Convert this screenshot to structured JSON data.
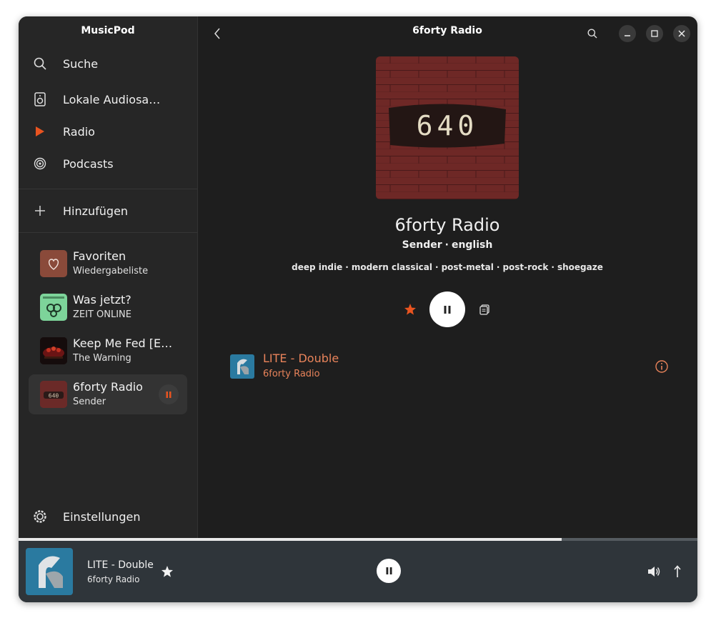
{
  "sidebar": {
    "app_title": "MusicPod",
    "nav": [
      {
        "label": "Suche",
        "icon": "search-icon"
      },
      {
        "label": "Lokale Audiosammlung",
        "icon": "local-audio-icon"
      },
      {
        "label": "Radio",
        "icon": "radio-play-icon"
      },
      {
        "label": "Podcasts",
        "icon": "podcast-icon"
      }
    ],
    "add_label": "Hinzufügen",
    "library": [
      {
        "title": "Favoriten",
        "subtitle": "Wiedergabeliste",
        "icon": "heart-icon"
      },
      {
        "title": "Was jetzt?",
        "subtitle": "ZEIT ONLINE"
      },
      {
        "title": "Keep Me Fed [Explicit]",
        "subtitle": "The Warning"
      },
      {
        "title": "6forty Radio",
        "subtitle": "Sender",
        "active": true
      }
    ],
    "settings_label": "Einstellungen"
  },
  "header": {
    "title": "6forty Radio"
  },
  "station": {
    "cover_text": "640",
    "name": "6forty Radio",
    "type": "Sender",
    "language": "english",
    "tags": [
      "deep indie",
      "modern classical",
      "post-metal",
      "post-rock",
      "shoegaze"
    ]
  },
  "current_track": {
    "title": "LITE - Double",
    "station": "6forty Radio"
  },
  "player": {
    "title": "LITE - Double",
    "subtitle": "6forty Radio",
    "progress": 0.8
  },
  "colors": {
    "accent": "#e95420",
    "track_accent": "#e8835a",
    "window_bg": "#1e1e1e",
    "sidebar_bg": "#262626",
    "bottom_bar_bg": "#2f353a"
  }
}
